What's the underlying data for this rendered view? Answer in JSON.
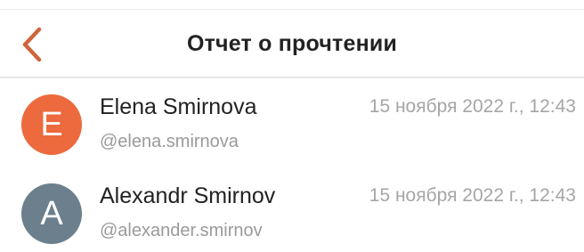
{
  "header": {
    "title": "Отчет о прочтении",
    "back_icon": "chevron-left-icon",
    "accent_color": "#d0643c"
  },
  "readers": [
    {
      "initial": "E",
      "avatar_color": "#ec6a3d",
      "name": "Elena Smirnova",
      "username": "@elena.smirnova",
      "read_at": "15 ноября 2022 г., 12:43"
    },
    {
      "initial": "A",
      "avatar_color": "#6b7f8c",
      "name": "Alexandr Smirnov",
      "username": "@alexander.smirnov",
      "read_at": "15 ноября 2022 г., 12:43"
    }
  ]
}
